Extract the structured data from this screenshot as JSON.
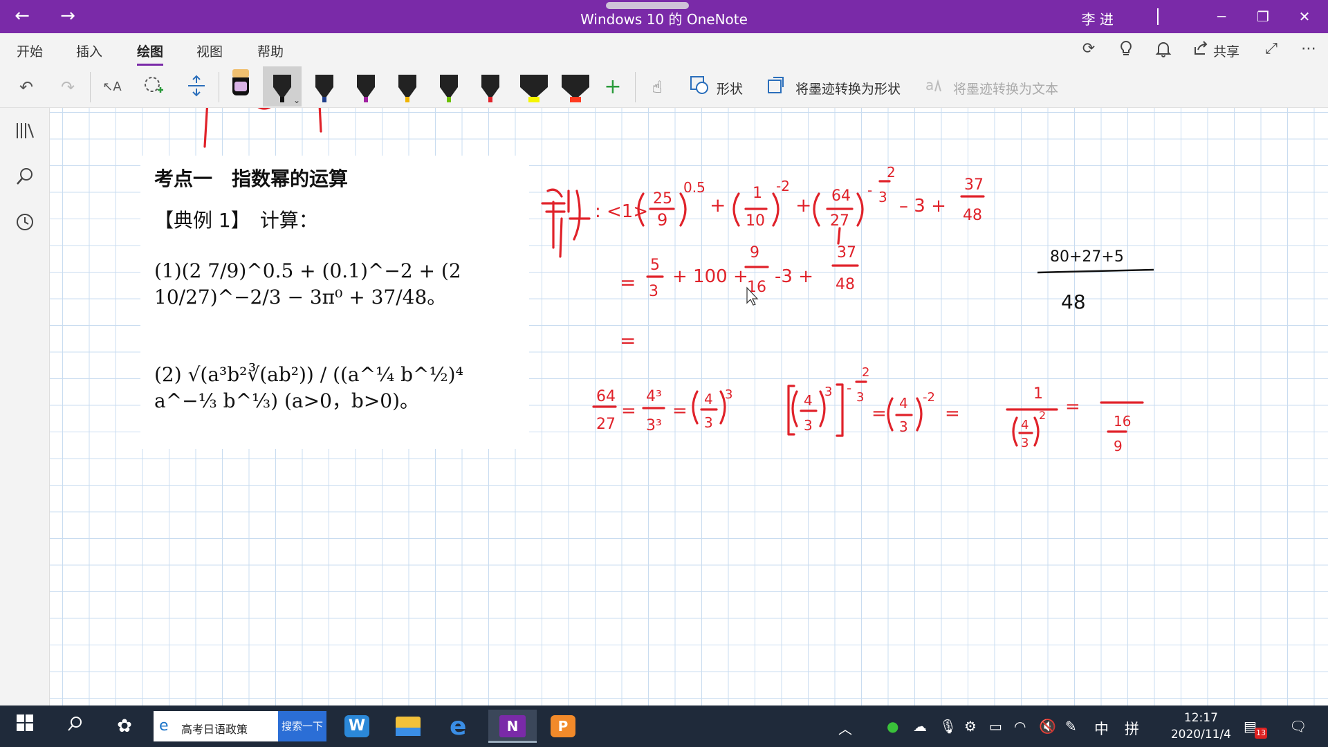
{
  "titlebar": {
    "title": "Windows 10 的 OneNote",
    "user": "李 进",
    "back": "←",
    "forward": "→",
    "minimize": "─",
    "restore": "❐",
    "close": "✕"
  },
  "ribbon": {
    "tabs": [
      {
        "label": "开始",
        "active": false
      },
      {
        "label": "插入",
        "active": false
      },
      {
        "label": "绘图",
        "active": true
      },
      {
        "label": "视图",
        "active": false
      },
      {
        "label": "帮助",
        "active": false
      }
    ],
    "share_label": "共享",
    "right_icons": [
      "sync-icon",
      "lightbulb-icon",
      "bell-icon",
      "share-icon",
      "fullscreen-icon",
      "more-icon"
    ]
  },
  "toolbar": {
    "pens": [
      {
        "color": "#d9b3e6",
        "selected": false
      },
      {
        "color": "#111111",
        "selected": true
      },
      {
        "color": "#1f3e8a",
        "selected": false
      },
      {
        "color": "#a020a0",
        "selected": false
      },
      {
        "color": "#f0b400",
        "selected": false
      },
      {
        "color": "#6cc000",
        "selected": false
      },
      {
        "color": "#e0222a",
        "selected": false
      },
      {
        "color": "#f5f500",
        "selected": false
      },
      {
        "color": "#ff3a20",
        "selected": false
      }
    ],
    "shapes_label": "形状",
    "ink_to_shape_label": "将墨迹转换为形状",
    "ink_to_text_label": "将墨迹转换为文本"
  },
  "page": {
    "heading": "考点一　指数幂的运算",
    "example": "【典例 1】　计算：",
    "formula1": "(1)(2 7/9)^0.5 + (0.1)^−2 + (2 10/27)^−2/3 − 3π⁰ + 37/48。",
    "formula2": "(2) √(a³b²∛(ab²)) / ((a^¼ b^½)⁴ a^−⅓ b^⅓)  (a>0，b>0)。"
  },
  "taskbar": {
    "search_text": "高考日语政策",
    "search_button": "搜索一下",
    "clock_time": "12:17",
    "clock_date": "2020/11/4",
    "ime": "中",
    "ime2": "拼",
    "notif_count": "13"
  },
  "colors": {
    "titlebar": "#7a2aa8",
    "ink": "#e0222a",
    "grid": "#c9dcf0"
  }
}
